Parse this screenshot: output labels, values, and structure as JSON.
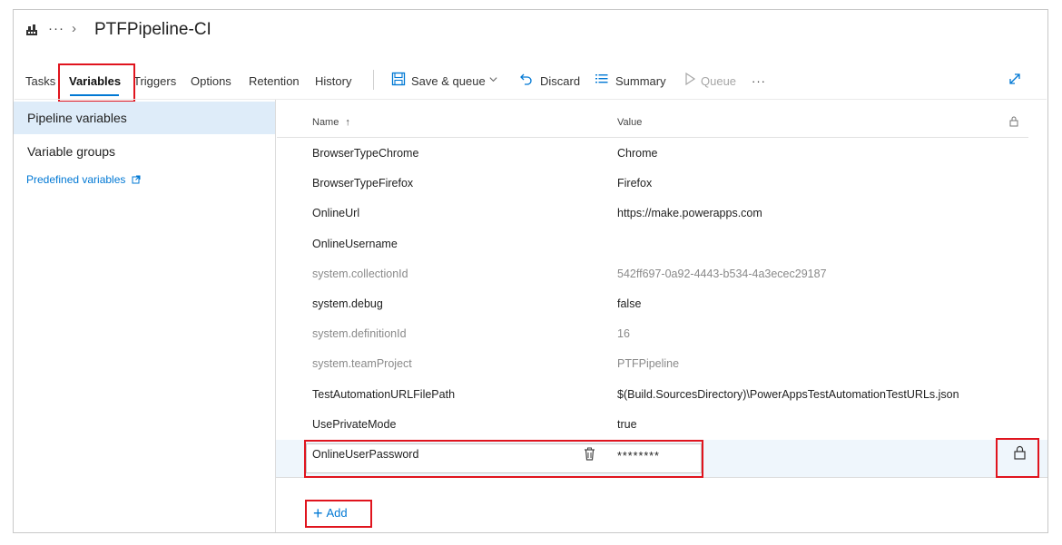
{
  "header": {
    "title": "PTFPipeline-CI",
    "ellipsis": "···",
    "chevron": "›"
  },
  "tabs": [
    {
      "label": "Tasks"
    },
    {
      "label": "Variables",
      "active": true
    },
    {
      "label": "Triggers"
    },
    {
      "label": "Options"
    },
    {
      "label": "Retention"
    },
    {
      "label": "History"
    }
  ],
  "toolbar": {
    "save_queue": "Save & queue",
    "discard": "Discard",
    "summary": "Summary",
    "queue": "Queue",
    "more": "···"
  },
  "left_pane": {
    "pipeline_variables": "Pipeline variables",
    "variable_groups": "Variable groups",
    "predefined_variables": "Predefined variables"
  },
  "grid": {
    "name_header": "Name",
    "sort_indicator": "↑",
    "value_header": "Value",
    "rows": [
      {
        "name": "BrowserTypeChrome",
        "value": "Chrome",
        "system": false
      },
      {
        "name": "BrowserTypeFirefox",
        "value": "Firefox",
        "system": false
      },
      {
        "name": "OnlineUrl",
        "value": "https://make.powerapps.com",
        "system": false
      },
      {
        "name": "OnlineUsername",
        "value": "",
        "system": false
      },
      {
        "name": "system.collectionId",
        "value": "542ff697-0a92-4443-b534-4a3ecec29187",
        "system": true
      },
      {
        "name": "system.debug",
        "value": "false",
        "system": false
      },
      {
        "name": "system.definitionId",
        "value": "16",
        "system": true
      },
      {
        "name": "system.teamProject",
        "value": "PTFPipeline",
        "system": true
      },
      {
        "name": "TestAutomationURLFilePath",
        "value": "$(Build.SourcesDirectory)\\PowerAppsTestAutomationTestURLs.json",
        "system": false
      },
      {
        "name": "UsePrivateMode",
        "value": "true",
        "system": false
      }
    ],
    "editing_row": {
      "name": "OnlineUserPassword",
      "value": "********"
    }
  },
  "add_label": "Add",
  "colors": {
    "accent": "#0078d4",
    "highlight": "#e0141e",
    "selected_bg": "#deecf9"
  }
}
